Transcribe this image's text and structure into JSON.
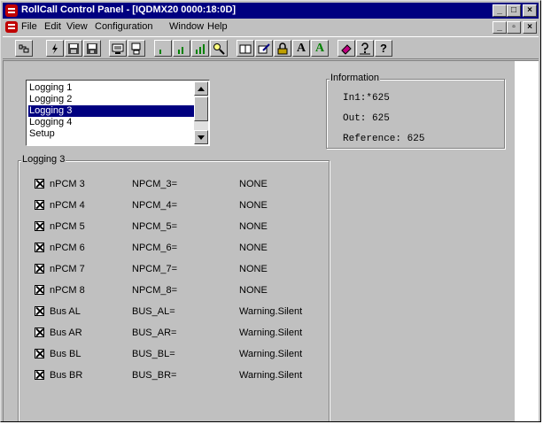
{
  "window": {
    "title": "RollCall Control Panel - [IQDMX20 0000:18:0D]",
    "caption_buttons": [
      "_",
      "□",
      "×"
    ],
    "mdi_buttons": [
      "_",
      "▫",
      "×"
    ]
  },
  "menu": {
    "items": [
      "File",
      "Edit",
      "View",
      "Configuration",
      "Window",
      "Help"
    ]
  },
  "toolbar": {
    "text_buttons": [
      "A",
      "A",
      "?"
    ]
  },
  "listbox": {
    "items": [
      "Logging 1",
      "Logging 2",
      "Logging 3",
      "Logging 4",
      "Setup"
    ],
    "selected_index": 2
  },
  "information": {
    "label": "Information",
    "in1": "In1:*625",
    "out": "Out: 625",
    "reference": "Reference: 625"
  },
  "logging": {
    "label": "Logging 3",
    "rows": [
      {
        "name": "nPCM 3",
        "key": "NPCM_3=",
        "value": "NONE",
        "checked": true
      },
      {
        "name": "nPCM 4",
        "key": "NPCM_4=",
        "value": "NONE",
        "checked": true
      },
      {
        "name": "nPCM 5",
        "key": "NPCM_5=",
        "value": "NONE",
        "checked": true
      },
      {
        "name": "nPCM 6",
        "key": "NPCM_6=",
        "value": "NONE",
        "checked": true
      },
      {
        "name": "nPCM 7",
        "key": "NPCM_7=",
        "value": "NONE",
        "checked": true
      },
      {
        "name": "nPCM 8",
        "key": "NPCM_8=",
        "value": "NONE",
        "checked": true
      },
      {
        "name": "Bus AL",
        "key": "BUS_AL=",
        "value": "Warning.Silent",
        "checked": true
      },
      {
        "name": "Bus AR",
        "key": "BUS_AR=",
        "value": "Warning.Silent",
        "checked": true
      },
      {
        "name": "Bus BL",
        "key": "BUS_BL=",
        "value": "Warning.Silent",
        "checked": true
      },
      {
        "name": "Bus BR",
        "key": "BUS_BR=",
        "value": "Warning.Silent",
        "checked": true
      }
    ]
  },
  "colors": {
    "titlebar": "#000080",
    "face": "#c0c0c0",
    "selection": "#000080",
    "app_icon": "#c00000"
  }
}
